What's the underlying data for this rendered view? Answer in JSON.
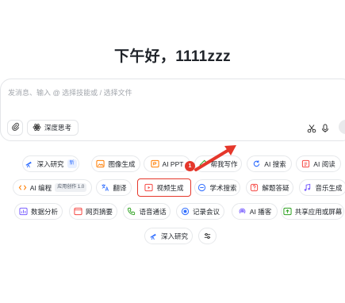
{
  "greeting": "下午好，1111zzz",
  "input": {
    "placeholder": "发消息、输入 @ 选择技能或 / 选择文件",
    "deep_think_label": "深度思考"
  },
  "chips": {
    "deep_research": {
      "label": "深入研究",
      "tag": "新"
    },
    "image_gen": {
      "label": "图像生成"
    },
    "ai_ppt": {
      "label": "AI PPT"
    },
    "write": {
      "label": "帮我写作"
    },
    "ai_search": {
      "label": "AI 搜索"
    },
    "ai_read": {
      "label": "AI 阅读"
    },
    "ai_code": {
      "label": "AI 编程",
      "tag": "应用创作 1.0"
    },
    "translate": {
      "label": "翻译"
    },
    "video_gen": {
      "label": "视频生成"
    },
    "scholar": {
      "label": "学术搜索"
    },
    "solve": {
      "label": "解题答疑"
    },
    "music": {
      "label": "音乐生成"
    },
    "data_analysis": {
      "label": "数据分析"
    },
    "web_summary": {
      "label": "网页摘要"
    },
    "voice_call": {
      "label": "语音通话"
    },
    "record_meeting": {
      "label": "记录会议"
    },
    "ai_podcast": {
      "label": "AI 播客"
    },
    "share_screen": {
      "label": "共享应用或屏幕"
    },
    "deep_research_2": {
      "label": "深入研究"
    }
  },
  "annotation": {
    "badge": "1",
    "highlight_color": "#e5372b"
  },
  "colors": {
    "accent_blue": "#3370ff",
    "orange": "#ff7d00",
    "purple": "#7b61ff",
    "green": "#2ea121",
    "red": "#f54a45"
  }
}
